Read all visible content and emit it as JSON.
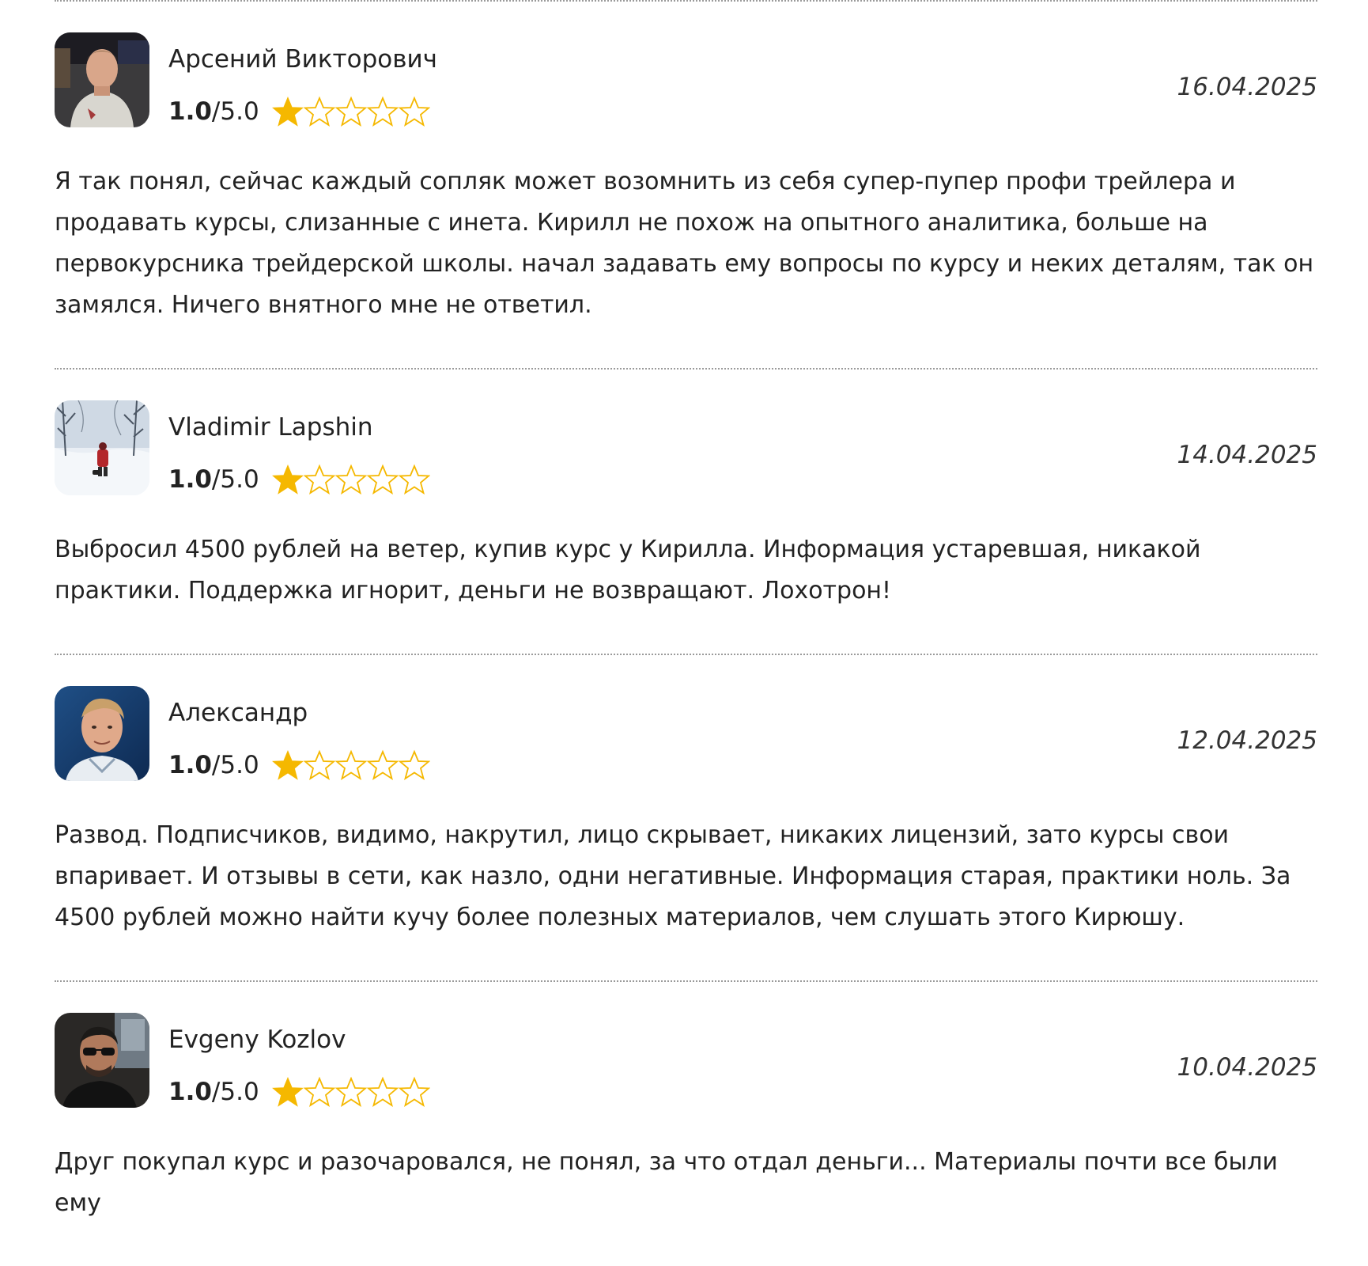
{
  "reviews": [
    {
      "author": "Арсений Викторович",
      "score": "1.0",
      "score_max": "/5.0",
      "rating_value": 1,
      "rating_out_of": 5,
      "date": "16.04.2025",
      "avatar_icon": "man-avatar-photo",
      "text": "Я так понял, сейчас каждый сопляк может возомнить из себя супер-пупер профи трейлера и продавать курсы, слизанные с инета. Кирилл не похож на опытного аналитика, больше на первокурсника трейдерской школы. начал задавать ему вопросы по курсу и неких деталям, так он замялся. Ничего внятного мне не ответил."
    },
    {
      "author": "Vladimir Lapshin",
      "score": "1.0",
      "score_max": "/5.0",
      "rating_value": 1,
      "rating_out_of": 5,
      "date": "14.04.2025",
      "avatar_icon": "winter-landscape-avatar-photo",
      "text": "Выбросил 4500 рублей на ветер, купив курс у Кирилла. Информация устаревшая, никакой практики. Поддержка игнорит, деньги не возвращают. Лохотрон!"
    },
    {
      "author": "Александр",
      "score": "1.0",
      "score_max": "/5.0",
      "rating_value": 1,
      "rating_out_of": 5,
      "date": "12.04.2025",
      "avatar_icon": "man-portrait-avatar-photo",
      "text": "Развод. Подписчиков, видимо, накрутил, лицо скрывает, никаких лицензий, зато курсы свои впаривает. И отзывы в сети, как назло, одни негативные. Информация старая, практики ноль. За 4500 рублей можно найти кучу более полезных материалов, чем слушать этого Кирюшу."
    },
    {
      "author": "Evgeny Kozlov",
      "score": "1.0",
      "score_max": "/5.0",
      "rating_value": 1,
      "rating_out_of": 5,
      "date": "10.04.2025",
      "avatar_icon": "man-sunglasses-avatar-photo",
      "text": "Друг покупал курс и разочаровался, не понял, за что отдал деньги... Материалы почти все были ему"
    }
  ],
  "colors": {
    "star_fill": "#F5B800",
    "star_outline": "#F5B800",
    "divider": "#9A9A9A",
    "text": "#222222"
  }
}
